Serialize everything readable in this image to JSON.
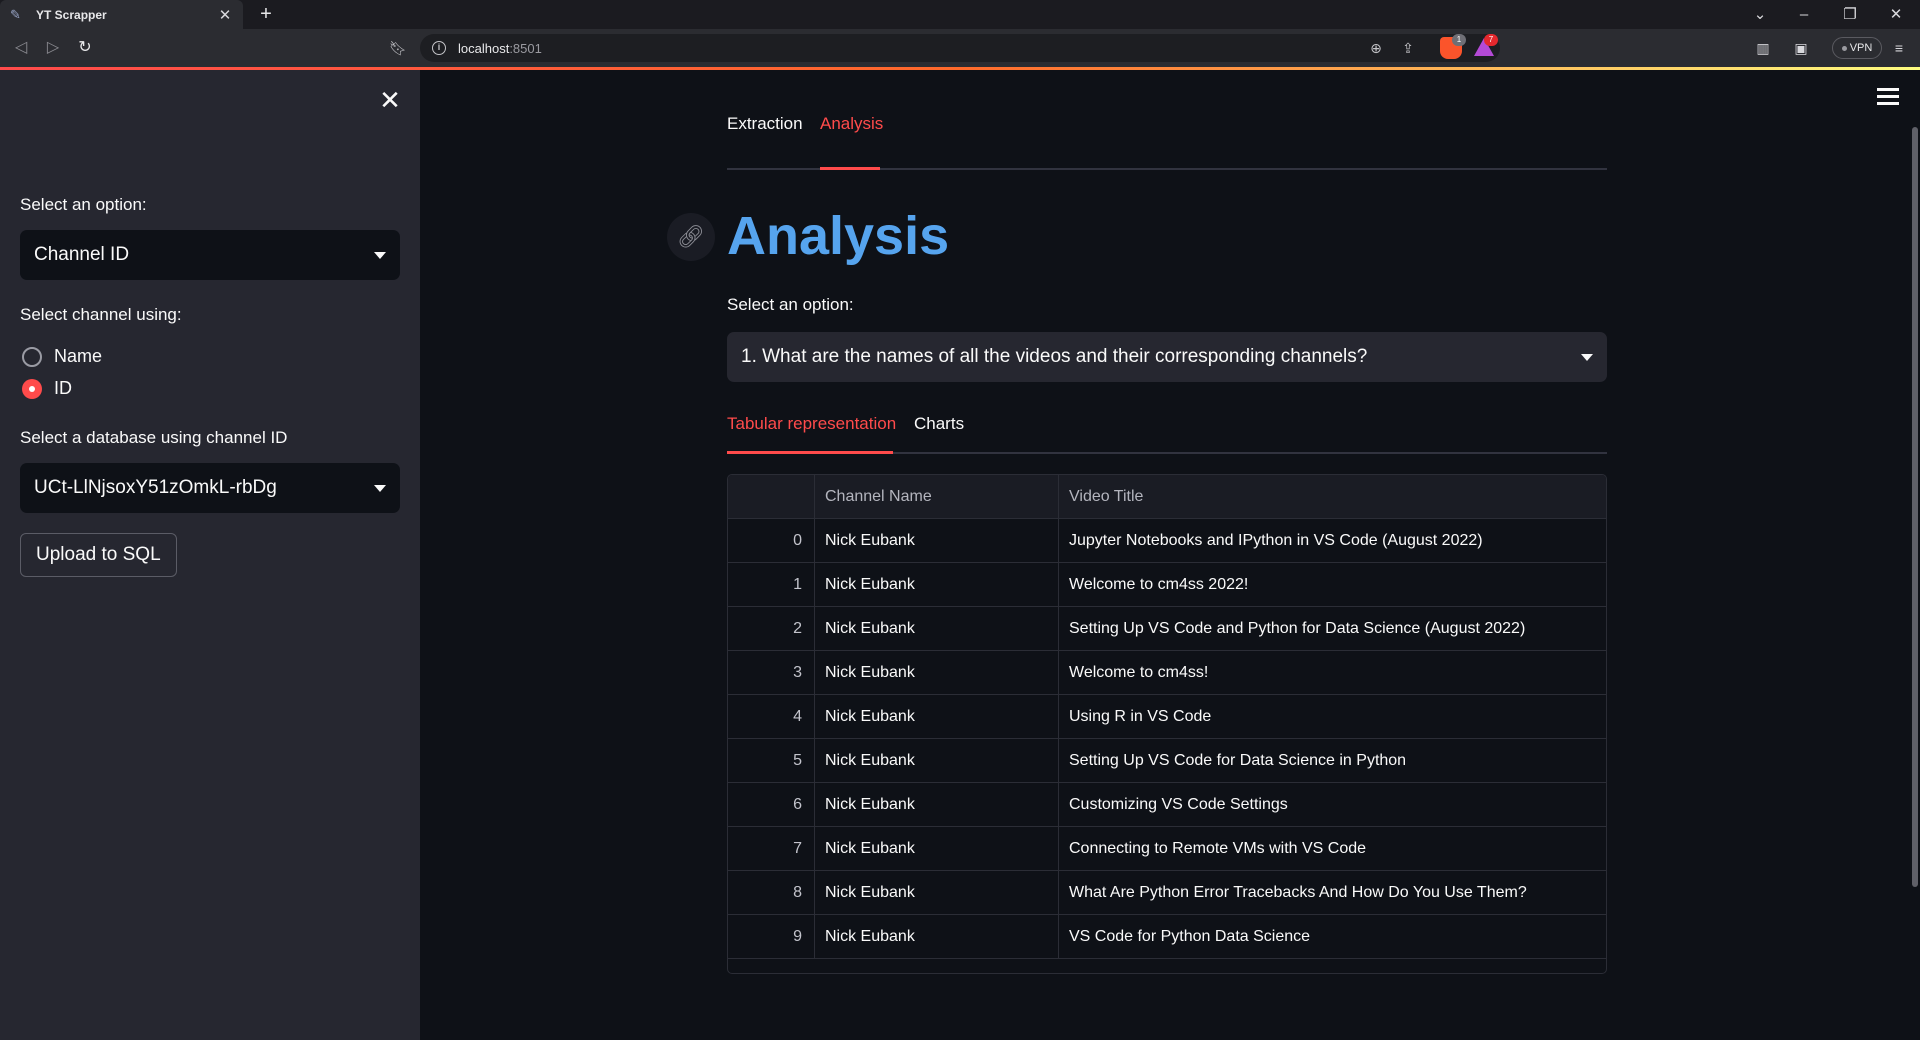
{
  "browser": {
    "tab_title": "YT Scrapper",
    "url_host": "localhost",
    "url_port": ":8501",
    "brave_badge": "1",
    "rewards_badge": "7",
    "vpn_label": "VPN"
  },
  "sidebar": {
    "option_label": "Select an option:",
    "option_value": "Channel ID",
    "channel_label": "Select channel using:",
    "radio_options": [
      "Name",
      "ID"
    ],
    "radio_selected": "ID",
    "database_label": "Select a database using channel ID",
    "database_value": "UCt-LlNjsoxY51zOmkL-rbDg",
    "upload_button": "Upload to SQL"
  },
  "main": {
    "tabs": [
      "Extraction",
      "Analysis"
    ],
    "active_tab": "Analysis",
    "title": "Analysis",
    "select_label": "Select an option:",
    "select_value": "1. What are the names of all the videos and their corresponding channels?",
    "subtabs": [
      "Tabular representation",
      "Charts"
    ],
    "active_subtab": "Tabular representation",
    "table": {
      "columns": [
        "Channel Name",
        "Video Title"
      ],
      "rows": [
        {
          "index": "0",
          "channel": "Nick Eubank",
          "title": "Jupyter Notebooks and IPython in VS Code (August 2022)"
        },
        {
          "index": "1",
          "channel": "Nick Eubank",
          "title": "Welcome to cm4ss 2022!"
        },
        {
          "index": "2",
          "channel": "Nick Eubank",
          "title": "Setting Up VS Code and Python for Data Science (August 2022)"
        },
        {
          "index": "3",
          "channel": "Nick Eubank",
          "title": "Welcome to cm4ss!"
        },
        {
          "index": "4",
          "channel": "Nick Eubank",
          "title": "Using R in VS Code"
        },
        {
          "index": "5",
          "channel": "Nick Eubank",
          "title": "Setting Up VS Code for Data Science in Python"
        },
        {
          "index": "6",
          "channel": "Nick Eubank",
          "title": "Customizing VS Code Settings"
        },
        {
          "index": "7",
          "channel": "Nick Eubank",
          "title": "Connecting to Remote VMs with VS Code"
        },
        {
          "index": "8",
          "channel": "Nick Eubank",
          "title": "What Are Python Error Tracebacks And How Do You Use Them?"
        },
        {
          "index": "9",
          "channel": "Nick Eubank",
          "title": "VS Code for Python Data Science"
        }
      ]
    }
  },
  "colors": {
    "accent": "#ff4b4b",
    "title_blue": "#56a4ee",
    "background": "#0e1117",
    "sidebar": "#262730"
  }
}
